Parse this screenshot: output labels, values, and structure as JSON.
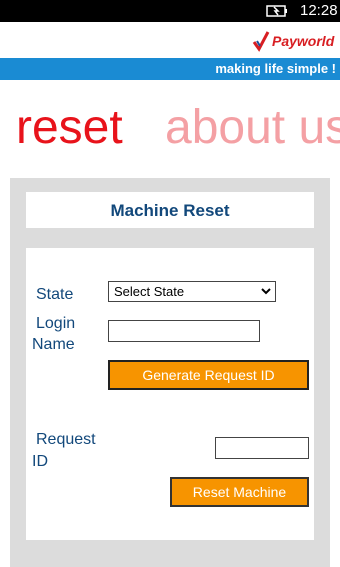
{
  "status_bar": {
    "time": "12:28",
    "battery_icon": "battery-charging-icon"
  },
  "header": {
    "brand": "Payworld",
    "tagline": "making life simple !"
  },
  "pivot": {
    "active": "reset",
    "inactive": "about us"
  },
  "form": {
    "title": "Machine Reset",
    "state_label": "State",
    "state_value": "Select State",
    "login_label_line1": "Login",
    "login_label_line2": "Name",
    "login_value": "",
    "generate_button": "Generate Request ID",
    "request_label_line1": "Request",
    "request_label_line2": "ID",
    "request_value": "",
    "reset_button": "Reset Machine"
  },
  "colors": {
    "accent_red": "#e8131b",
    "brand_blue": "#1a8bd3",
    "label_blue": "#12487b",
    "button_orange": "#f79400"
  }
}
